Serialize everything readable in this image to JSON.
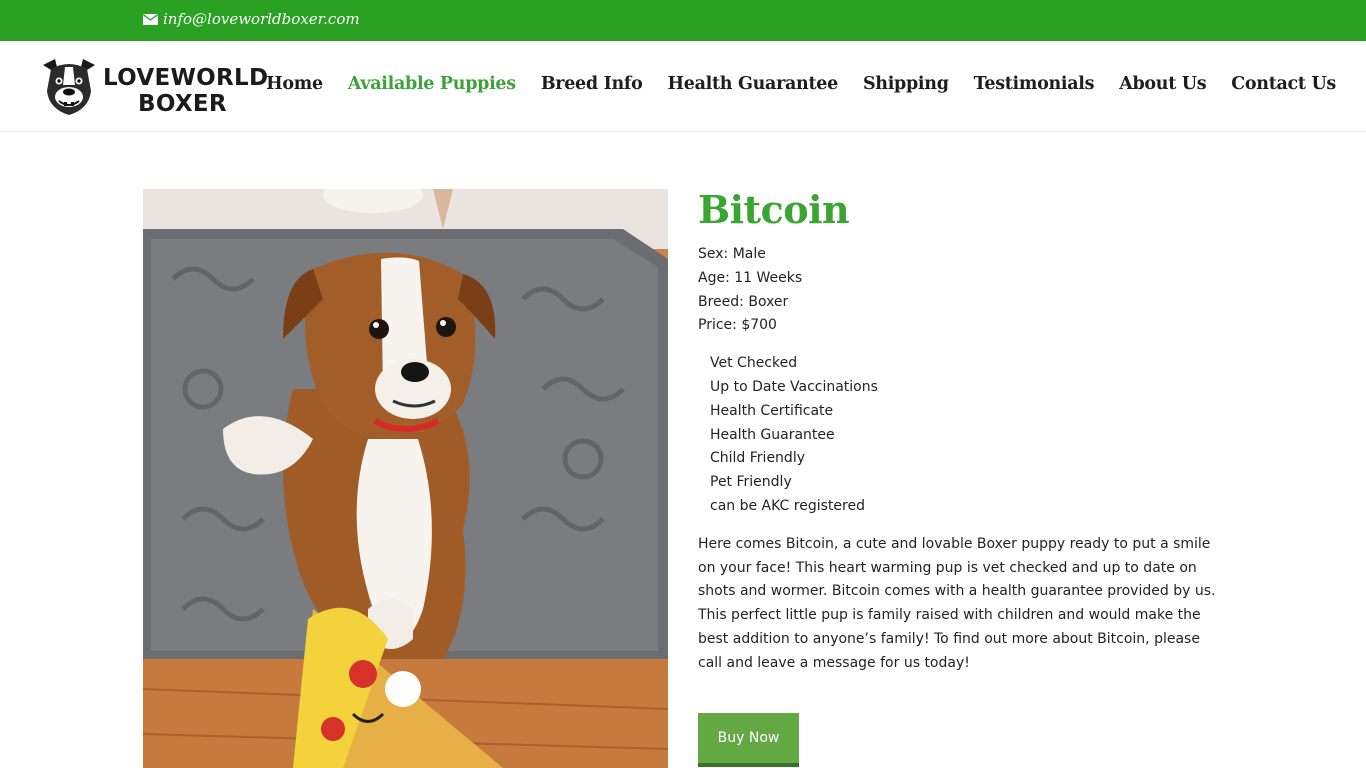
{
  "topbar": {
    "email": "info@loveworldboxer.com",
    "email_icon": "envelope-icon",
    "bg_color": "#2aa122"
  },
  "brand": {
    "line1": "LOVEWORLD",
    "line2": "BOXER",
    "logo_icon": "boxer-dog-face-icon"
  },
  "nav": {
    "items": [
      {
        "label": "Home"
      },
      {
        "label": "Available Puppies",
        "active": true
      },
      {
        "label": "Breed Info"
      },
      {
        "label": "Health Guarantee"
      },
      {
        "label": "Shipping"
      },
      {
        "label": "Testimonials"
      },
      {
        "label": "About Us"
      },
      {
        "label": "Contact Us"
      }
    ],
    "active_color": "#3ea23a"
  },
  "puppy": {
    "name": "Bitcoin",
    "sex": "Sex: Male",
    "age": "Age: 11 Weeks",
    "breed": "Breed: Boxer",
    "price": "Price: $700",
    "features": [
      "Vet Checked",
      "Up to Date Vaccinations",
      "Health Certificate",
      "Health Guarantee",
      "Child Friendly",
      "Pet Friendly",
      "can be AKC registered"
    ],
    "description": "Here comes Bitcoin, a cute and lovable Boxer puppy ready to put a smile on your face! This heart warming pup is vet checked and up to date on shots and wormer. Bitcoin comes with a health guarantee provided by us. This perfect little pup is family raised with children and would make the best addition to anyone’s family! To find out more about Bitcoin, please call and leave a message for us today!",
    "buy_label": "Buy Now",
    "title_color": "#3aa531",
    "button_color": "#64a844"
  }
}
